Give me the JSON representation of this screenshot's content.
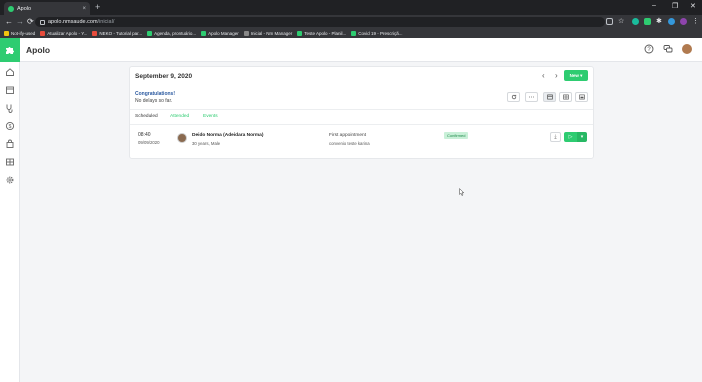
{
  "browser": {
    "tab_title": "Apolo",
    "tab_close": "×",
    "new_tab": "+",
    "back": "←",
    "forward": "→",
    "reload": "⟳",
    "url_host": "apolo.nmsaude.com",
    "url_path": "/inicial/",
    "window_minimize": "–",
    "window_maximize": "❐",
    "window_close": "✕"
  },
  "bookmarks": [
    {
      "label": "Not-ify-used",
      "color": "#f1c40f"
    },
    {
      "label": "Atualizar Apolo - Y...",
      "color": "#e74c3c"
    },
    {
      "label": "NEKO - Tutorial par...",
      "color": "#e74c3c"
    },
    {
      "label": "Agenda, prontuário...",
      "color": "#2ecc71"
    },
    {
      "label": "Apolo Manager",
      "color": "#2ecc71"
    },
    {
      "label": "Inicial - Nm Manager",
      "color": "#888888"
    },
    {
      "label": "Teste Apolo - Planil...",
      "color": "#2ecc71"
    },
    {
      "label": "Covid 19 - Prescriçã...",
      "color": "#2ecc71"
    }
  ],
  "app": {
    "title": "Apolo",
    "accent": "#2ecc71"
  },
  "schedule": {
    "date": "September 9, 2020",
    "prev": "‹",
    "next": "›",
    "new_label": "New ▾",
    "congrats": "Congratulations!",
    "no_delays": "No delays so far.",
    "more_label": "⋯",
    "tabs": [
      "Scheduled",
      "Attended",
      "Events"
    ]
  },
  "appointment": {
    "time": "08:40",
    "date": "09/09/2020",
    "patient_name": "Deido Norma (Adeidara Norma)",
    "patient_info": "30 years, Male",
    "type": "First appointment",
    "insurance": "convenio teste karina",
    "status": "Confirmed",
    "play_icon": "▷",
    "drop_icon": "▾",
    "download_icon": "⤓"
  }
}
